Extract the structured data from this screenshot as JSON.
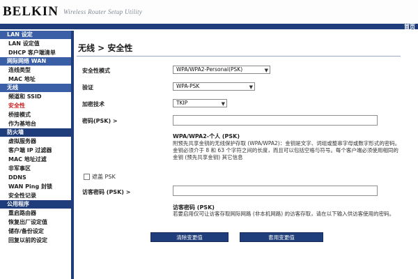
{
  "header": {
    "logo": "BELKIN",
    "app_title": "Wireless Router Setup Utility",
    "top_link": "首页"
  },
  "sidebar": {
    "sections": [
      {
        "title": "LAN 设定",
        "items": [
          {
            "label": "LAN 设定值",
            "active": false
          },
          {
            "label": "DHCP 客户端清单",
            "active": false
          }
        ]
      },
      {
        "title": "网际网络 WAN",
        "items": [
          {
            "label": "连线类型",
            "active": false
          },
          {
            "label": "MAC 地址",
            "active": false
          }
        ]
      },
      {
        "title": "无线",
        "items": [
          {
            "label": "频道和 SSID",
            "active": false
          },
          {
            "label": "安全性",
            "active": true
          },
          {
            "label": "桥接模式",
            "active": false
          },
          {
            "label": "作为基地台",
            "active": false
          }
        ]
      },
      {
        "title": "防火墙",
        "items": [
          {
            "label": "虚拟服务器",
            "active": false
          },
          {
            "label": "客户端 IP 过滤器",
            "active": false
          },
          {
            "label": "MAC 地址过滤",
            "active": false
          },
          {
            "label": "非军事区",
            "active": false
          },
          {
            "label": "DDNS",
            "active": false
          },
          {
            "label": "WAN Ping 封锁",
            "active": false
          },
          {
            "label": "安全性记录",
            "active": false
          }
        ]
      },
      {
        "title": "公用程序",
        "items": [
          {
            "label": "重启路由器",
            "active": false
          },
          {
            "label": "恢复出厂设定值",
            "active": false
          },
          {
            "label": "储存/备份设定",
            "active": false
          },
          {
            "label": "回复以前的设定",
            "active": false
          }
        ]
      }
    ]
  },
  "main": {
    "title": "无线 > 安全性",
    "security_mode_label": "安全性模式",
    "security_mode_value": "WPA/WPA2-Personal(PSK)",
    "auth_label": "验证",
    "auth_value": "WPA-PSK",
    "encryption_label": "加密技术",
    "encryption_value": "TKIP",
    "password_label": "密码(PSK) >",
    "password_value": "",
    "help1_title": "WPA/WPA2-个人 (PSK)",
    "help1_text": "附预先共享金钥的无线保护存取 (WPA/WPA2)：金钥是文字、词组或整串字母或数字形式的密码。金钥必须介于 8 和 63 个字符之间的长度，而且可以包括空格与符号。每个客户端必须使用相同的金钥 (预先共享金钥) 其它信息",
    "obscure_label": "遮盖 PSK",
    "obscure_checked": false,
    "guest_label": "访客密码 (PSK) >",
    "guest_value": "",
    "help2_title": "访客密码 (PSK)",
    "help2_text": "若要启用仅可让访客存取网际网路 (非本机网路) 的访客存取，请在以下输入供访客使用的密码。",
    "clear_button": "清除变更值",
    "apply_button": "套用变更值"
  },
  "colors": {
    "nav_dark": "#1f3d7a",
    "nav_light": "#3a5fa6",
    "active_item": "#cc2222"
  }
}
